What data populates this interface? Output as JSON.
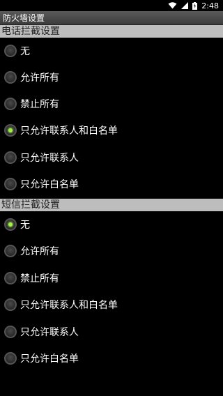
{
  "status_bar": {
    "time": "2:48",
    "icons": [
      "wifi-icon",
      "signal-icon",
      "battery-icon"
    ],
    "battery_label": "⚡"
  },
  "app": {
    "title": "防火墙设置"
  },
  "sections": [
    {
      "header": "电话拦截设置",
      "options": [
        {
          "label": "无",
          "checked": false
        },
        {
          "label": "允许所有",
          "checked": false
        },
        {
          "label": "禁止所有",
          "checked": false
        },
        {
          "label": "只允许联系人和白名单",
          "checked": true
        },
        {
          "label": "只允许联系人",
          "checked": false
        },
        {
          "label": "只允许白名单",
          "checked": false
        }
      ]
    },
    {
      "header": "短信拦截设置",
      "options": [
        {
          "label": "无",
          "checked": true
        },
        {
          "label": "允许所有",
          "checked": false
        },
        {
          "label": "禁止所有",
          "checked": false
        },
        {
          "label": "只允许联系人和白名单",
          "checked": false
        },
        {
          "label": "只允许联系人",
          "checked": false
        },
        {
          "label": "只允许白名单",
          "checked": false
        }
      ]
    }
  ],
  "colors": {
    "accent": "#9cf53a",
    "header_bg": "#bdbdbd",
    "background": "#000000"
  }
}
